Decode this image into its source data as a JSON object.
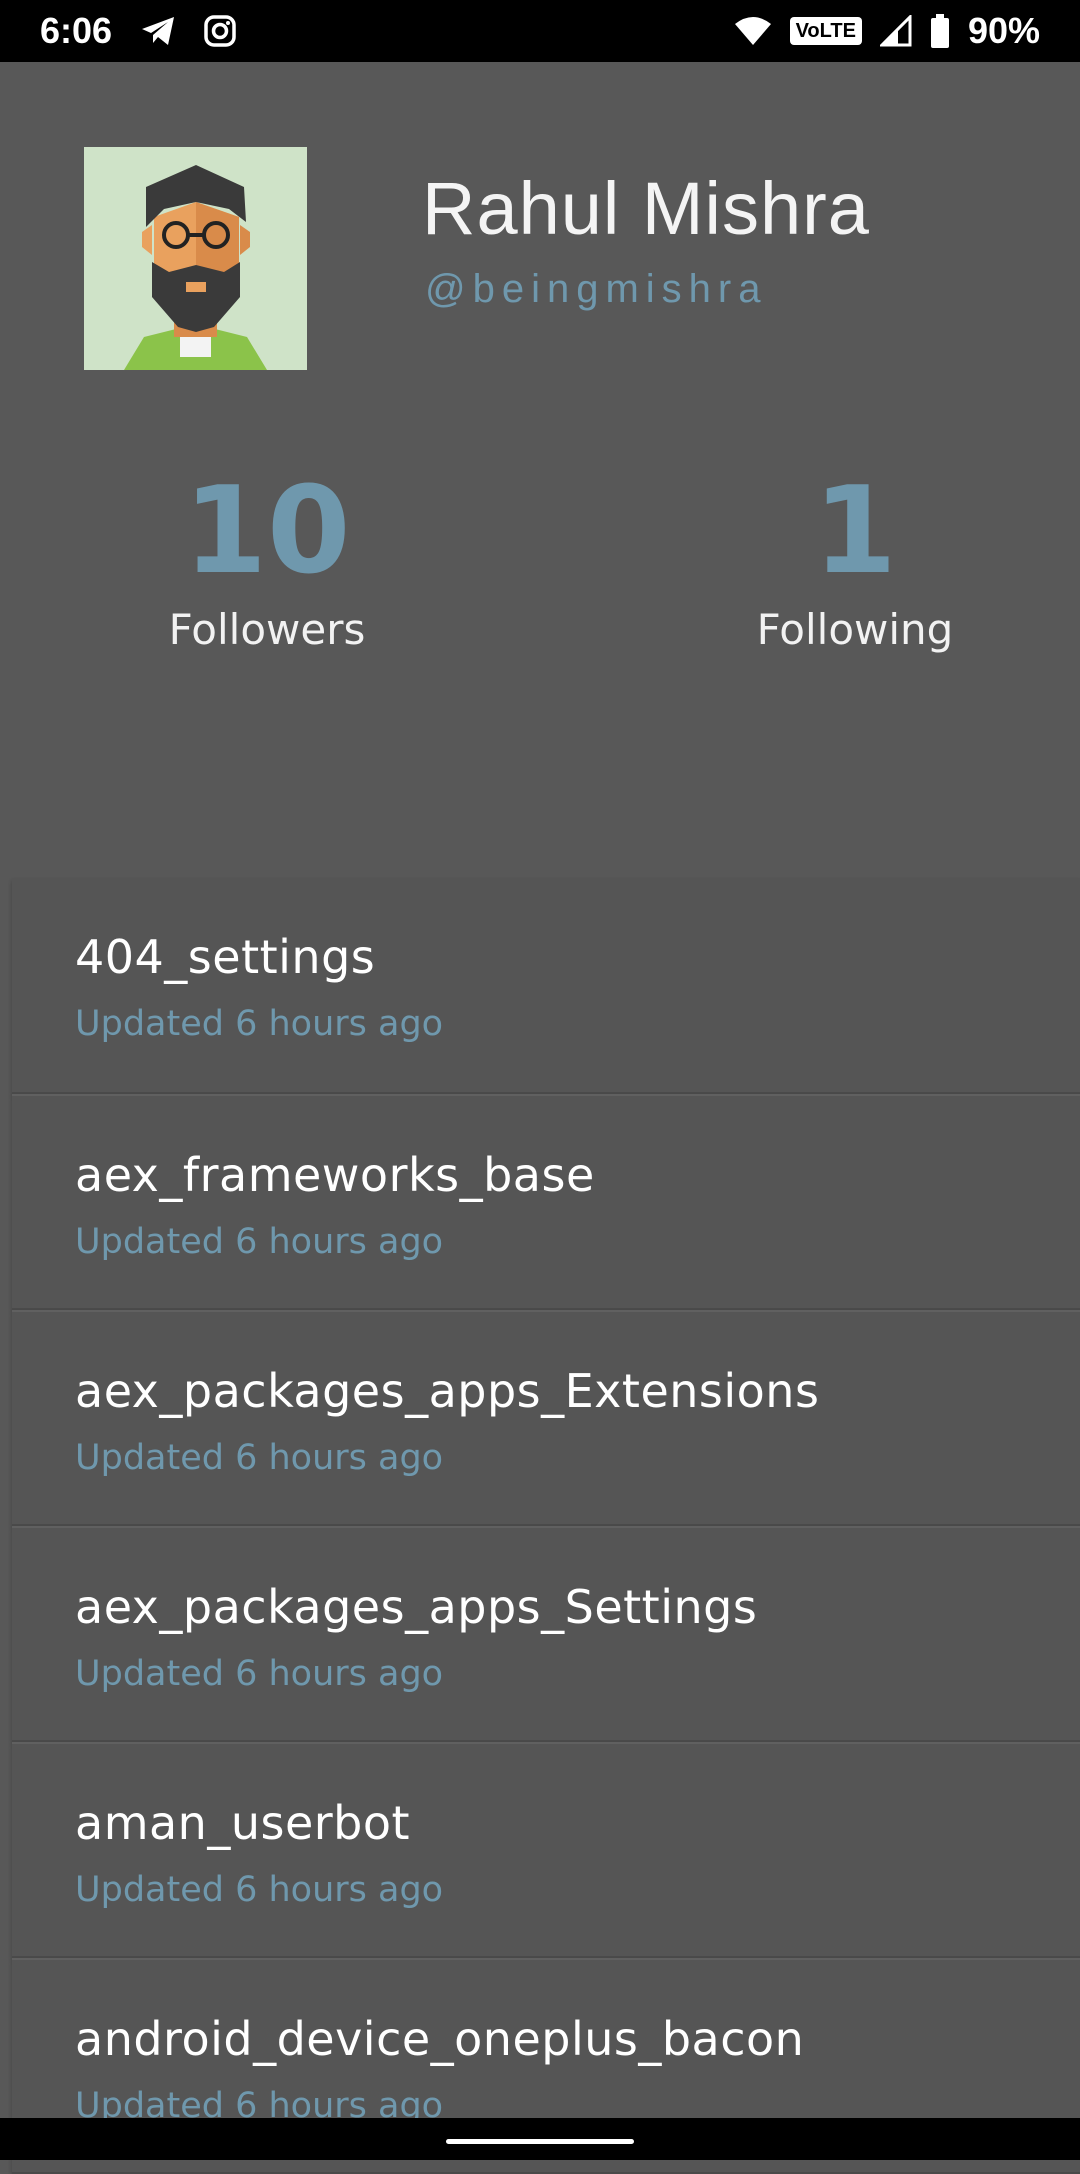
{
  "status_bar": {
    "time": "6:06",
    "left_icons": [
      "telegram-icon",
      "instagram-icon"
    ],
    "right_icons": [
      "wifi-icon",
      "volte-icon",
      "signal-icon",
      "battery-icon"
    ],
    "volte_label": "VoLTE",
    "battery": "90%"
  },
  "profile": {
    "name": "Rahul Mishra",
    "handle": "@beingmishra",
    "avatar": "avatar-illustration",
    "followers": {
      "count": "10",
      "label": "Followers"
    },
    "following": {
      "count": "1",
      "label": "Following"
    }
  },
  "repos": [
    {
      "name": "404_settings",
      "updated": "Updated 6 hours ago"
    },
    {
      "name": "aex_frameworks_base",
      "updated": "Updated 6 hours ago"
    },
    {
      "name": "aex_packages_apps_Extensions",
      "updated": "Updated 6 hours ago"
    },
    {
      "name": "aex_packages_apps_Settings",
      "updated": "Updated 6 hours ago"
    },
    {
      "name": "aman_userbot",
      "updated": "Updated 6 hours ago"
    },
    {
      "name": "android_device_oneplus_bacon",
      "updated": "Updated 6 hours ago"
    }
  ],
  "colors": {
    "background": "#585858",
    "accent": "#6f98ad",
    "status_bar": "#000000"
  }
}
